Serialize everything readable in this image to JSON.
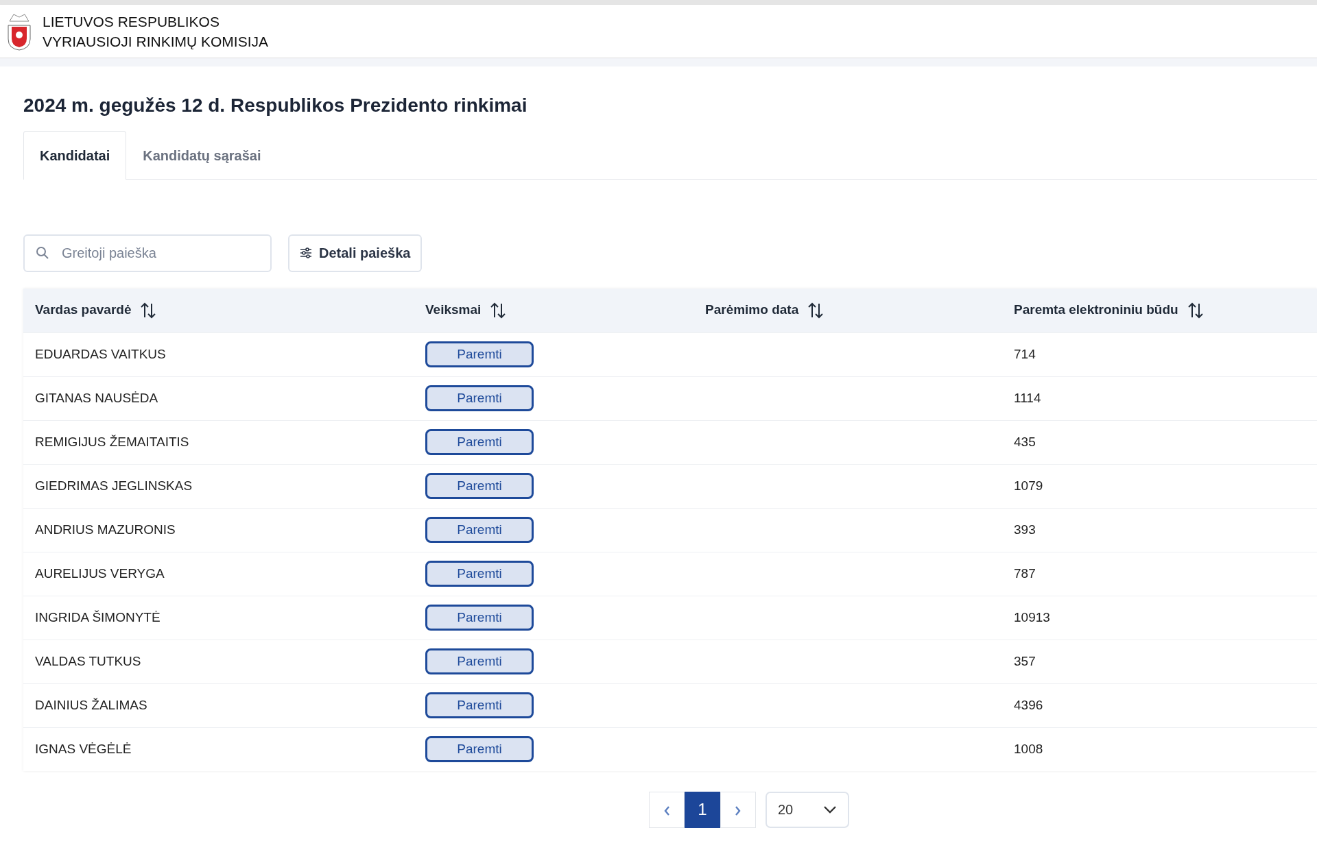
{
  "header": {
    "org_line_1": "LIETUVOS RESPUBLIKOS",
    "org_line_2": "VYRIAUSIOJI RINKIMŲ KOMISIJA"
  },
  "title": "2024 m. gegužės 12 d. Respublikos Prezidento rinkimai",
  "tabs": [
    {
      "label": "Kandidatai",
      "selected": true
    },
    {
      "label": "Kandidatų sąrašai",
      "selected": false
    }
  ],
  "search": {
    "placeholder": "Greitoji paieška"
  },
  "detail_search_button": "Detali paieška",
  "table": {
    "columns": [
      "Vardas pavardė",
      "Veiksmai",
      "Parėmimo data",
      "Paremta elektroniniu būdu"
    ],
    "rows": [
      {
        "name": "EDUARDAS VAITKUS",
        "action": "Paremti",
        "count": "714"
      },
      {
        "name": "GITANAS NAUSĖDA",
        "action": "Paremti",
        "count": "1114"
      },
      {
        "name": "REMIGIJUS ŽEMAITAITIS",
        "action": "Paremti",
        "count": "435"
      },
      {
        "name": "GIEDRIMAS JEGLINSKAS",
        "action": "Paremti",
        "count": "1079"
      },
      {
        "name": "ANDRIUS MAZURONIS",
        "action": "Paremti",
        "count": "393"
      },
      {
        "name": "AURELIJUS VERYGA",
        "action": "Paremti",
        "count": "787"
      },
      {
        "name": "INGRIDA ŠIMONYTĖ",
        "action": "Paremti",
        "count": "10913"
      },
      {
        "name": "VALDAS TUTKUS",
        "action": "Paremti",
        "count": "357"
      },
      {
        "name": "DAINIUS ŽALIMAS",
        "action": "Paremti",
        "count": "4396"
      },
      {
        "name": "IGNAS VĖGĖLĖ",
        "action": "Paremti",
        "count": "1008"
      }
    ]
  },
  "pagination": {
    "pages": [
      {
        "label": "1",
        "selected": true
      }
    ],
    "page_size": "20"
  }
}
